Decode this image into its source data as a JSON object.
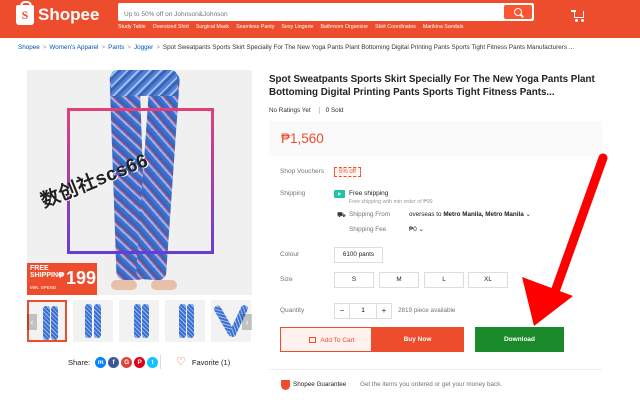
{
  "header": {
    "logo_letter": "S",
    "logo_text": "Shopee",
    "search_placeholder": "Up to 50% off on Johnson&Johnson",
    "suggestions": [
      "Study Table",
      "Oversized Shirt",
      "Surgical Mask",
      "Seamless Panty",
      "Sexy Lingerie",
      "Bathroom Organizer",
      "Skirt Coordinates",
      "Marikina Sandals"
    ]
  },
  "breadcrumb": {
    "items": [
      "Shopee",
      "Women's Apparel",
      "Pants",
      "Jogger"
    ],
    "current": "Spot Sweatpants Sports Skirt Specially For The New Yoga Pants Plant Bottoming Digital Printing Pants Sports Tight Fitness Pants Manufacturers ..."
  },
  "gallery": {
    "watermark": "数创社scs66",
    "badge_free": "FREE",
    "badge_shipping": "SHIPPING",
    "badge_min": "MIN. SPEND",
    "badge_peso": "₱",
    "badge_amount": "199",
    "thumb_count": 5
  },
  "share": {
    "label": "Share:",
    "networks": [
      {
        "icon": "messenger-icon",
        "glyph": "m",
        "color": "#0084ff"
      },
      {
        "icon": "facebook-icon",
        "glyph": "f",
        "color": "#3b5999"
      },
      {
        "icon": "google-icon",
        "glyph": "G",
        "color": "#db4437"
      },
      {
        "icon": "pinterest-icon",
        "glyph": "P",
        "color": "#de0217"
      },
      {
        "icon": "twitter-icon",
        "glyph": "t",
        "color": "#10c2ff"
      }
    ]
  },
  "favorite": {
    "label": "Favorite (1)"
  },
  "product": {
    "title": "Spot Sweatpants Sports Skirt Specially For The New Yoga Pants Plant Bottoming Digital Printing Pants Sports Tight Fitness Pants...",
    "ratings": "No Ratings Yet",
    "sold_count": "0",
    "sold_label": "Sold",
    "price": "₱1,560"
  },
  "details": {
    "vouchers_label": "Shop Vouchers",
    "voucher": "5% off",
    "shipping_label": "Shipping",
    "free_shipping": "Free shipping",
    "free_shipping_sub": "Free shipping with min order of ₱99",
    "ship_from_label": "Shipping From",
    "ship_from_prefix": "overseas to",
    "ship_from_dest": "Metro Manila, Metro Manila",
    "ship_fee_label": "Shipping Fee",
    "ship_fee": "₱0",
    "colour_label": "Colour",
    "colour_option": "6100 pants",
    "size_label": "Size",
    "sizes": [
      "S",
      "M",
      "L",
      "XL"
    ],
    "quantity_label": "Quantity",
    "quantity": "1",
    "available": "2819 piece available"
  },
  "actions": {
    "add_to_cart": "Add To Cart",
    "buy_now": "Buy Now",
    "download": "Download"
  },
  "guarantee": {
    "title": "Shopee Guarantee",
    "text": "Get the items you ordered or get your money back."
  },
  "colors": {
    "brand": "#ee4d2d",
    "download": "#1b8a2a",
    "arrow": "#ff0000"
  }
}
